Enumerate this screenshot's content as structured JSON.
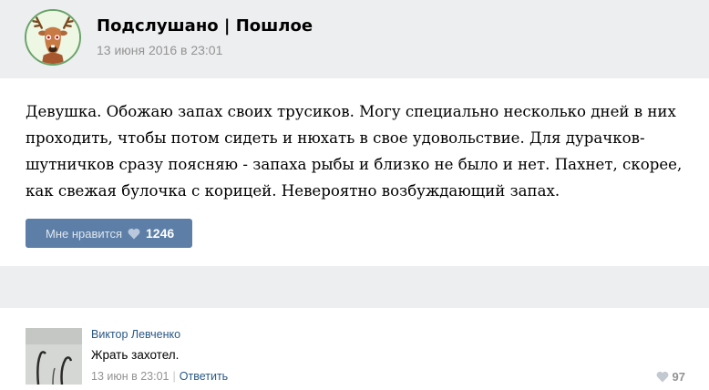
{
  "post": {
    "group_name": "Подслушано | Пошлое",
    "date": "13 июня 2016 в 23:01",
    "text": "Девушка. Обожаю запах своих трусиков. Могу специально несколько дней в них проходить, чтобы потом сидеть и нюхать в свое удовольствие. Для дурачков-шутничков сразу поясняю - запаха рыбы и близко не было и нет. Пахнет, скорее, как свежая булочка с корицей. Невероятно возбуждающий запах.",
    "like_label": "Мне нравится",
    "like_count": "1246"
  },
  "comment": {
    "author": "Виктор Левченко",
    "text": "Жрать захотел.",
    "date": "13 июн в 23:01",
    "separator": "|",
    "reply_label": "Ответить",
    "like_count": "97"
  },
  "colors": {
    "accent": "#5d7fa7",
    "link": "#2a5885",
    "muted": "#939393",
    "band": "#edeef0"
  },
  "icons": [
    "deer-avatar-icon",
    "heart-icon"
  ]
}
